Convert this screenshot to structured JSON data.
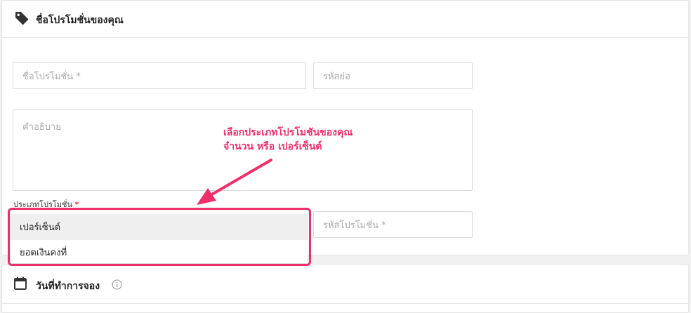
{
  "promotion_card": {
    "title": "ชื่อโปรโมชั่นของคุณ",
    "icon": "tag-icon",
    "name_field": {
      "placeholder": "ชื่อโปรโมชั่น *"
    },
    "code_field": {
      "placeholder": "รหัสย่อ"
    },
    "description_field": {
      "placeholder": "คำอธิบาย"
    },
    "type_field": {
      "label": "ประเภทโปรโมชั่น",
      "required_mark": "*",
      "options": [
        "เปอร์เซ็นต์",
        "ยอดเงินคงที่"
      ],
      "selected": "เปอร์เซ็นต์"
    },
    "promo_code_field": {
      "placeholder": "รหัสโปรโมชั่น *"
    }
  },
  "booking_card": {
    "title": "วันที่ทำการจอง",
    "icon": "calendar-icon",
    "info_icon": "info-icon"
  },
  "annotation": {
    "line1": "เลือกประเภทโปรโมชันของคุณ",
    "line2": "จำนวน หรือ เปอร์เซ็นต์",
    "color": "#ef2f6c"
  }
}
